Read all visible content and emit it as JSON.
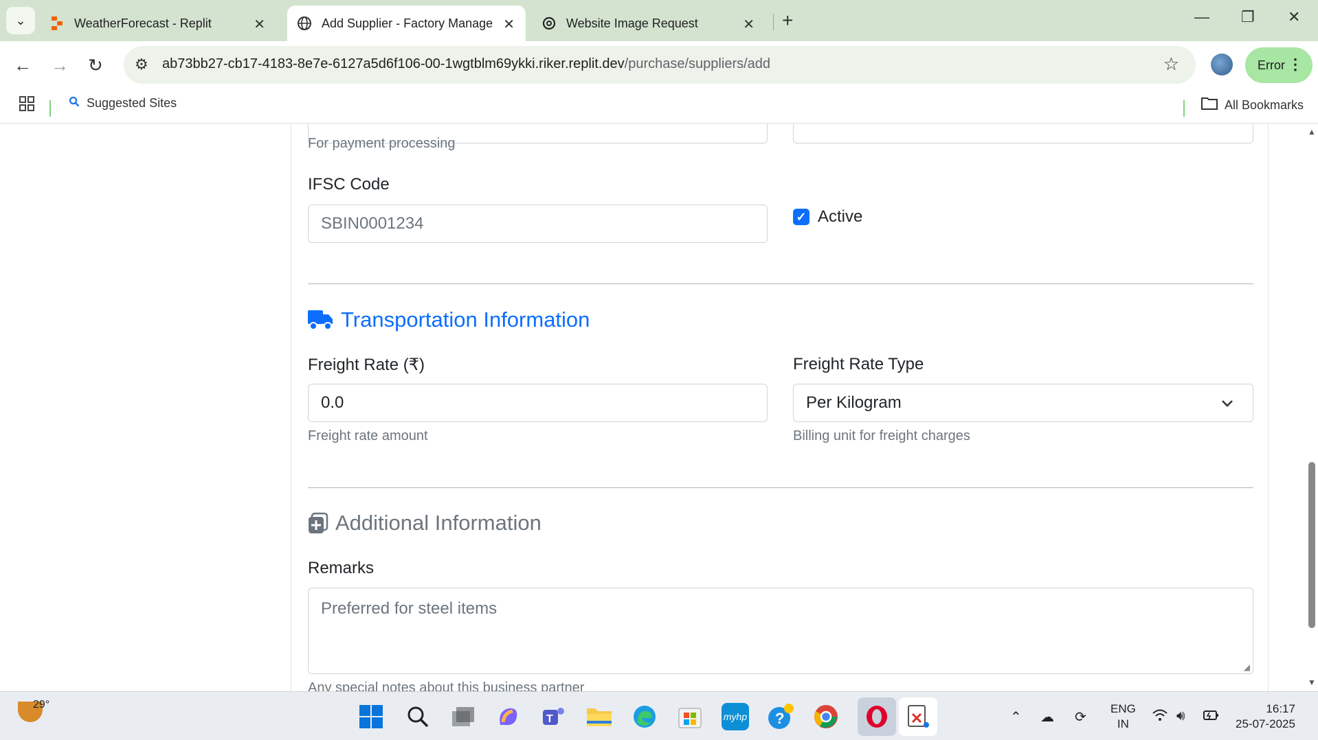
{
  "browser": {
    "tabs": [
      {
        "title": "WeatherForecast - Replit",
        "icon": "replit-icon"
      },
      {
        "title": "Add Supplier - Factory Manager",
        "icon": "globe-icon"
      },
      {
        "title": "Website Image Request",
        "icon": "openai-icon"
      }
    ],
    "url_host": "ab73bb27-cb17-4183-8e7e-6127a5d6f106-00-1wgtblm69ykki.riker.replit.dev",
    "url_path": "/purchase/suppliers/add",
    "profile_status": "Error",
    "bookmarks": {
      "suggested": "Suggested Sites",
      "all": "All Bookmarks"
    }
  },
  "form": {
    "payment_help": "For payment processing",
    "ifsc": {
      "label": "IFSC Code",
      "value": "SBIN0001234"
    },
    "active": {
      "label": "Active",
      "checked": true
    },
    "transport": {
      "title": "Transportation Information",
      "freight_rate": {
        "label": "Freight Rate (₹)",
        "value": "0.0",
        "help": "Freight rate amount"
      },
      "freight_type": {
        "label": "Freight Rate Type",
        "value": "Per Kilogram",
        "help": "Billing unit for freight charges"
      }
    },
    "additional": {
      "title": "Additional Information",
      "remarks": {
        "label": "Remarks",
        "value": "Preferred for steel items",
        "help": "Any special notes about this business partner"
      }
    }
  },
  "taskbar": {
    "temperature": "29°",
    "lang_line1": "ENG",
    "lang_line2": "IN",
    "time": "16:17",
    "date": "25-07-2025"
  },
  "colors": {
    "primary": "#0d6efd",
    "muted": "#6c757d",
    "tab_strip": "#d3e3cf"
  }
}
